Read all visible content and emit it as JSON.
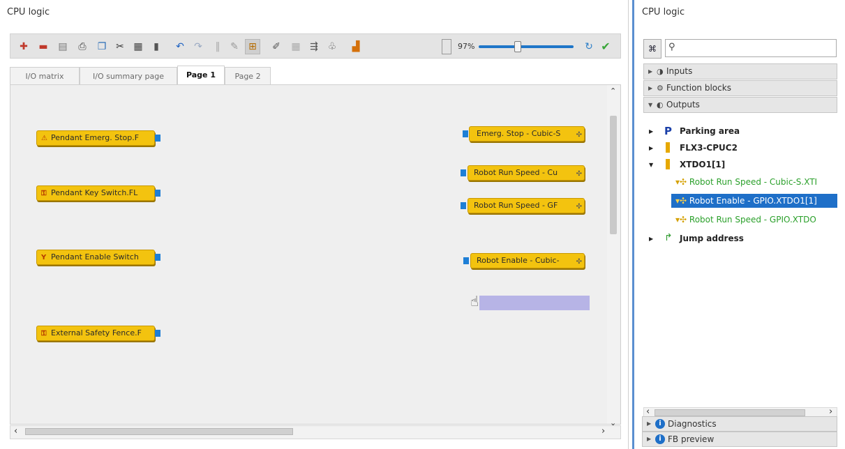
{
  "left_panel": {
    "title": "CPU logic",
    "toolbar": {
      "zoom_label": "97%",
      "zoom_level_percent": 97,
      "icons": [
        "add-page-icon",
        "remove-page-icon",
        "page-icon",
        "print-icon",
        "copy-icon",
        "cut-icon",
        "paste-icon",
        "delete-icon",
        "undo-icon",
        "redo-icon",
        "align-icon",
        "pencil-icon",
        "grid-icon",
        "properties-icon",
        "layout-icon",
        "connect-icon",
        "tag-icon",
        "module-icon",
        "page-fit-icon",
        "zoom-reset-icon",
        "check-icon"
      ]
    },
    "tabs": [
      "I/O matrix",
      "I/O summary page",
      "Page 1",
      "Page 2"
    ],
    "selected_tab": "Page 1",
    "inputs": [
      {
        "label": "Pendant Emerg. Stop.F",
        "icon": "emergency-stop-icon"
      },
      {
        "label": "Pendant Key Switch.FL",
        "icon": "key-switch-icon"
      },
      {
        "label": "Pendant Enable Switch",
        "icon": "enable-switch-icon"
      },
      {
        "label": "External Safety Fence.F",
        "icon": "fence-icon"
      }
    ],
    "outputs": [
      {
        "label": "Emerg. Stop - Cubic-S",
        "icon": "robot-icon"
      },
      {
        "label": "Robot Run Speed - Cu",
        "icon": "robot-icon"
      },
      {
        "label": "Robot Run Speed - GF",
        "icon": "robot-icon"
      },
      {
        "label": "Robot Enable - Cubic-",
        "icon": "robot-icon"
      }
    ]
  },
  "right_panel": {
    "title": "CPU logic",
    "search": {
      "placeholder": ""
    },
    "sections": [
      {
        "label": "Inputs",
        "expanded": false
      },
      {
        "label": "Function blocks",
        "expanded": false
      },
      {
        "label": "Outputs",
        "expanded": true
      }
    ],
    "tree": [
      {
        "label": "Parking area"
      },
      {
        "label": "FLX3-CPUC2"
      },
      {
        "label": "XTDO1[1]"
      },
      {
        "label": "Jump address"
      }
    ],
    "tree_leaves": [
      {
        "label": "Robot Run Speed - Cubic-S.XTI",
        "selected": false
      },
      {
        "label": "Robot Enable - GPIO.XTDO1[1]",
        "selected": true
      },
      {
        "label": "Robot Run Speed - GPIO.XTDO",
        "selected": false
      }
    ],
    "bottom_sections": [
      "Diagnostics",
      "FB preview"
    ]
  },
  "colors": {
    "node_fill": "#f3c30f",
    "port": "#1e7fd6",
    "selection": "#1e6fc8",
    "leaf_text": "#2ba02b"
  }
}
